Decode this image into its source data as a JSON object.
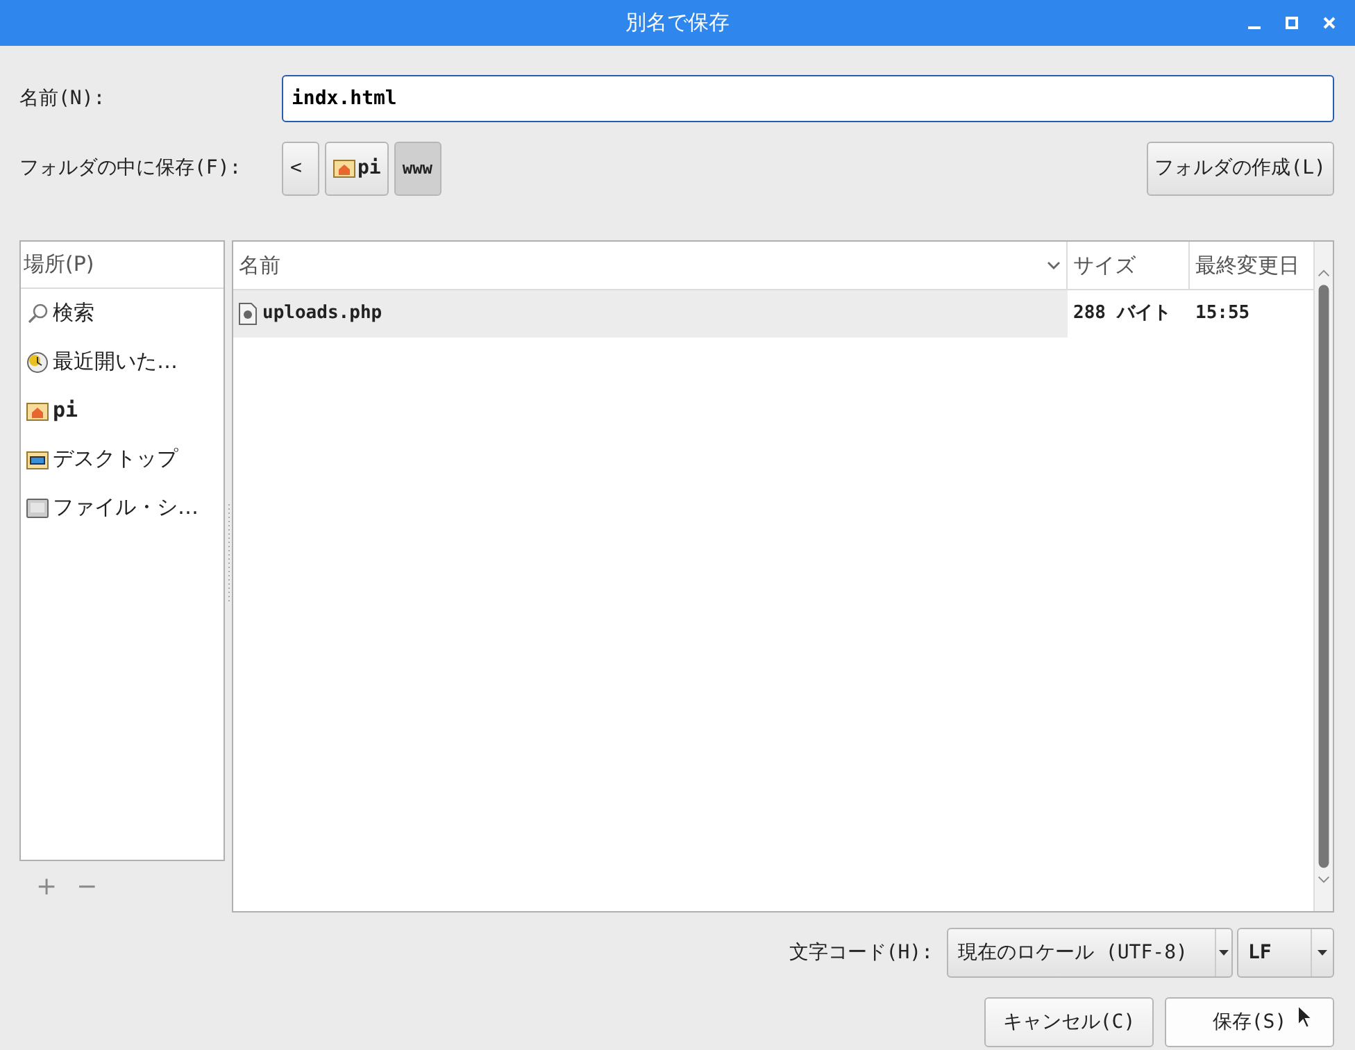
{
  "window": {
    "title": "別名で保存"
  },
  "name_field": {
    "label": "名前(N):",
    "value": "indx.html"
  },
  "folder_row": {
    "label": "フォルダの中に保存(F):",
    "path": [
      {
        "kind": "back",
        "label": "<",
        "selected": false
      },
      {
        "kind": "home",
        "label": "pi",
        "selected": false
      },
      {
        "kind": "folder",
        "label": "www",
        "selected": true
      }
    ],
    "create_button": "フォルダの作成(L)"
  },
  "places": {
    "header": "場所(P)",
    "items": [
      {
        "kind": "search",
        "label": "検索"
      },
      {
        "kind": "recent",
        "label": "最近開いた…"
      },
      {
        "kind": "home",
        "label": "pi"
      },
      {
        "kind": "desktop",
        "label": "デスクトップ"
      },
      {
        "kind": "drive",
        "label": "ファイル・シ…"
      }
    ],
    "add_button": {
      "label": "+",
      "disabled": true
    },
    "remove_button": {
      "label": "−",
      "disabled": true
    }
  },
  "file_list": {
    "columns": [
      {
        "label": "名前",
        "sorted": true
      },
      {
        "label": "サイズ",
        "sorted": false
      },
      {
        "label": "最終変更日",
        "sorted": false
      }
    ],
    "rows": [
      {
        "name": "uploads.php",
        "size": "288 バイト",
        "modified": "15:55"
      }
    ]
  },
  "encoding": {
    "label": "文字コード(H):",
    "value": "現在のロケール (UTF-8)",
    "line_ending": "LF"
  },
  "buttons": [
    {
      "label": "キャンセル(C)",
      "hovered": false
    },
    {
      "label": "保存(S)",
      "hovered": true
    }
  ]
}
